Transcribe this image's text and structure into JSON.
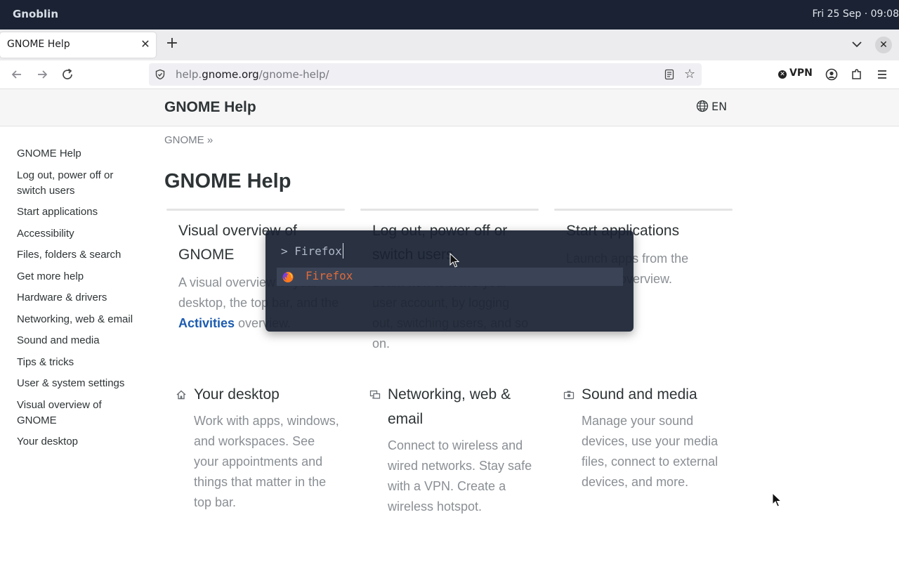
{
  "topbar": {
    "app_name": "Gnoblin",
    "datetime": "Fri 25 Sep · 09:08"
  },
  "browser": {
    "tab": {
      "title": "GNOME Help",
      "close": "✕"
    },
    "new_tab": "+",
    "url": {
      "prefix": "help.",
      "domain": "gnome.org",
      "path": "/gnome-help/"
    },
    "vpn_label": "VPN"
  },
  "page": {
    "brand": "GNOME Help",
    "language": "EN",
    "breadcrumb": "GNOME »",
    "title": "GNOME Help",
    "sidebar": [
      "GNOME Help",
      "Log out, power off or switch users",
      "Start applications",
      "Accessibility",
      "Files, folders & search",
      "Get more help",
      "Hardware & drivers",
      "Networking, web & email",
      "Sound and media",
      "Tips & tricks",
      "User & system settings",
      "Visual overview of GNOME",
      "Your desktop"
    ],
    "cards_top": [
      {
        "title": "Visual overview of GNOME",
        "desc_before": "A visual overview of your desktop, the top bar, and the ",
        "desc_link": "Activities",
        "desc_after": " overview."
      },
      {
        "title": "Log out, power off or switch users",
        "desc": "Learn how to leave your user account, by logging out, switching users, and so on."
      },
      {
        "title": "Start applications",
        "desc": "Launch apps from the Activities overview."
      }
    ],
    "cards_bottom": [
      {
        "icon": "home-icon",
        "title": "Your desktop",
        "desc": "Work with apps, windows, and workspaces. See your appointments and things that matter in the top bar."
      },
      {
        "icon": "network-icon",
        "title": "Networking, web & email",
        "desc": "Connect to wireless and wired networks. Stay safe with a VPN. Create a wireless hotspot."
      },
      {
        "icon": "camera-icon",
        "title": "Sound and media",
        "desc": "Manage your sound devices, use your media files, connect to external devices, and more."
      }
    ]
  },
  "launcher": {
    "prompt": "> Firefox",
    "result": "Firefox"
  },
  "colors": {
    "topbar": "#1a2233",
    "link": "#1c5bb0",
    "launcher_accent": "#e06a3a"
  }
}
